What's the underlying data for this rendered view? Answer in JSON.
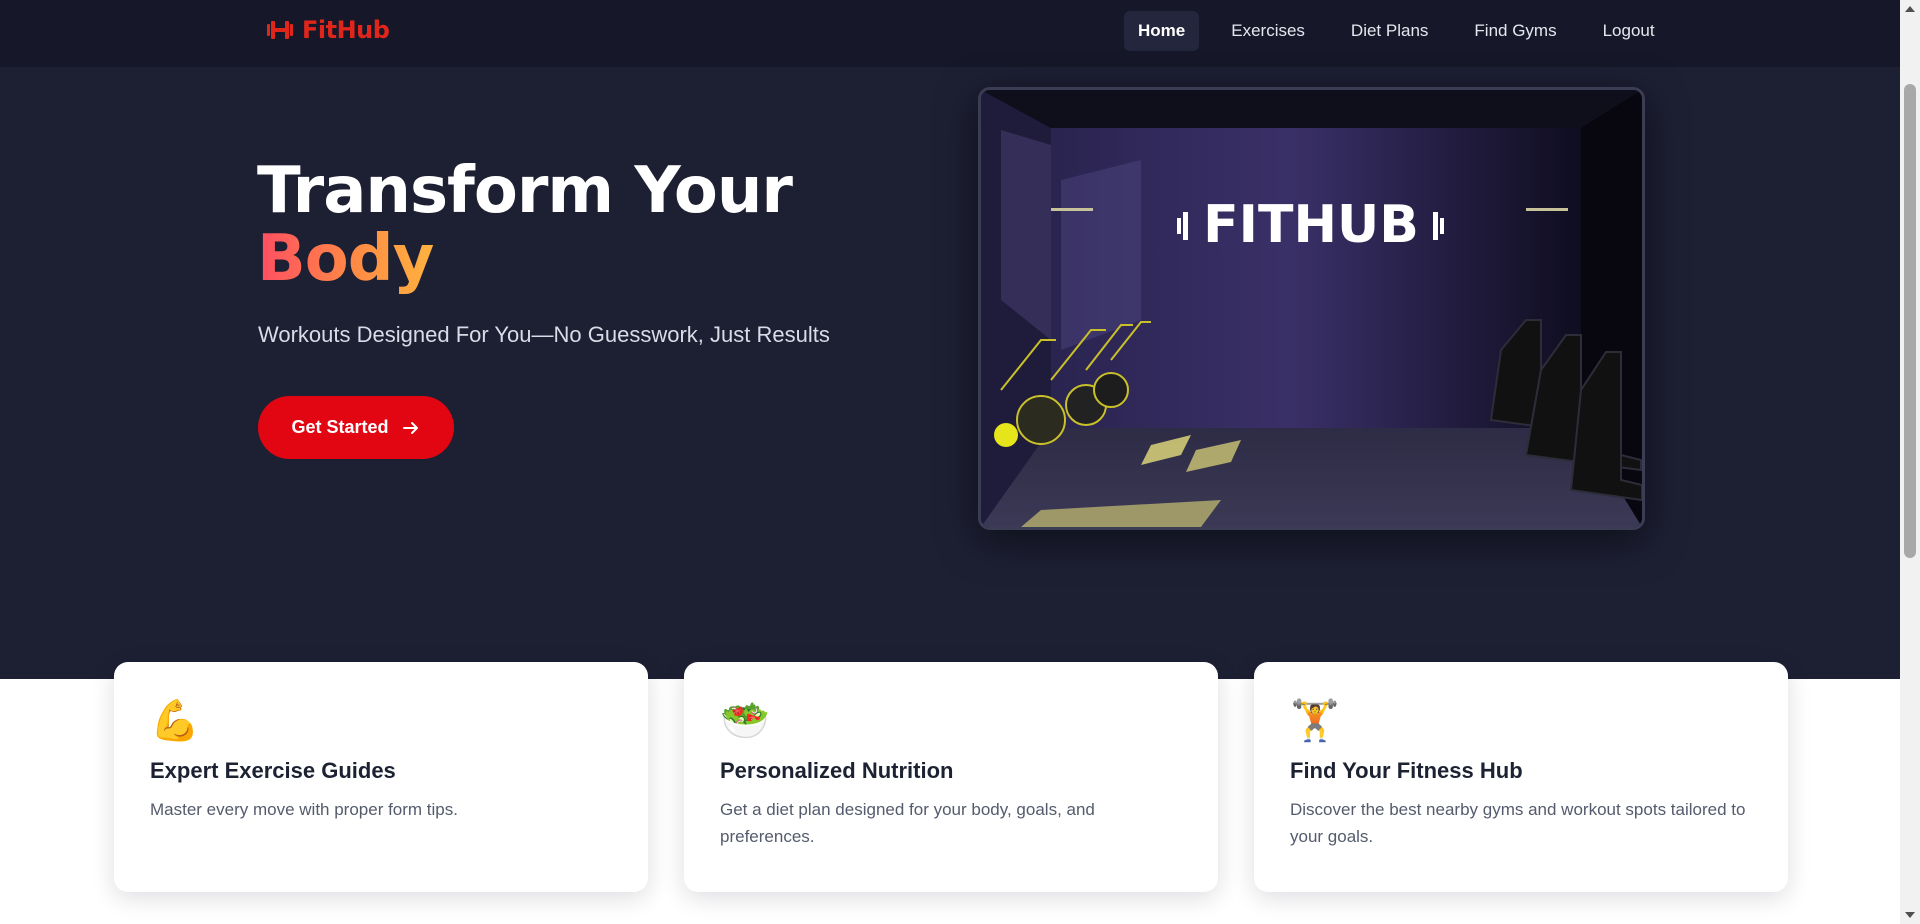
{
  "brand": {
    "name": "FitHub",
    "logo_icon": "dumbbell-icon",
    "accent": "#e0261b"
  },
  "nav": {
    "items": [
      {
        "label": "Home",
        "active": true
      },
      {
        "label": "Exercises"
      },
      {
        "label": "Diet Plans"
      },
      {
        "label": "Find Gyms"
      },
      {
        "label": "Logout"
      }
    ]
  },
  "hero": {
    "title_line1": "Transform Your",
    "title_line2": "Body",
    "subtitle": "Workouts Designed For You—No Guesswork, Just Results",
    "cta_label": "Get Started",
    "cta_icon": "arrow-right-icon",
    "cta_color": "#e20613",
    "image_sign": "FITHUB"
  },
  "features": [
    {
      "emoji": "💪",
      "icon": "flexed-biceps-icon",
      "title": "Expert Exercise Guides",
      "text": "Master every move with proper form tips."
    },
    {
      "emoji": "🥗",
      "icon": "salad-bowl-icon",
      "title": "Personalized Nutrition",
      "text": "Get a diet plan designed for your body, goals, and preferences."
    },
    {
      "emoji": "🏋️",
      "icon": "weightlifter-icon",
      "title": "Find Your Fitness Hub",
      "text": "Discover the best nearby gyms and workout spots tailored to your goals."
    }
  ],
  "colors": {
    "nav_bg": "#161829",
    "hero_bg": "#1d1f33",
    "card_bg": "#ffffff"
  }
}
